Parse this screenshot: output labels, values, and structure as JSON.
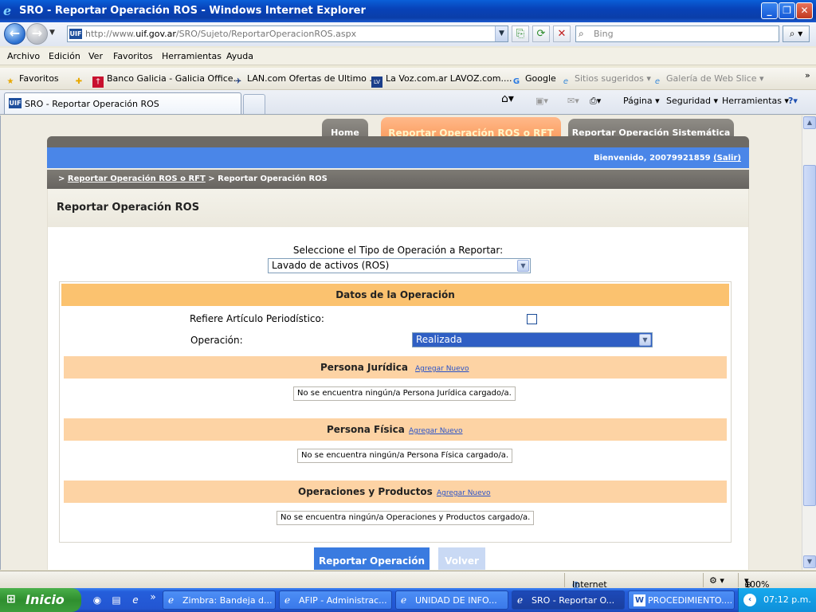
{
  "window": {
    "title": "SRO - Reportar Operación ROS - Windows Internet Explorer"
  },
  "address": {
    "url_prefix": "http://www.",
    "url_domain": "uif.gov.ar",
    "url_path": "/SRO/Sujeto/ReportarOperacionROS.aspx",
    "site_icon": "UIF"
  },
  "search": {
    "placeholder": "Bing"
  },
  "menu": {
    "items": [
      "Archivo",
      "Edición",
      "Ver",
      "Favoritos",
      "Herramientas",
      "Ayuda"
    ]
  },
  "favorites": {
    "label": "Favoritos",
    "items": [
      "Banco Galicia - Galicia Office...",
      "LAN.com Ofertas de Ultimo ...",
      "La Voz.com.ar  LAVOZ.com....",
      "Google",
      "Sitios sugeridos ▾",
      "Galería de Web Slice ▾"
    ]
  },
  "browser_tab": {
    "title": "SRO - Reportar Operación ROS"
  },
  "command_bar": {
    "pagina": "Página ▾",
    "seguridad": "Seguridad ▾",
    "herramientas": "Herramientas ▾"
  },
  "site_nav": {
    "home": "Home",
    "reportar_ros_rft": "Reportar Operación ROS o RFT",
    "reportar_sistematica": "Reportar Operación Sistemática"
  },
  "user_band": {
    "welcome": "Bienvenido, 20079921859",
    "salir": "(Salir)"
  },
  "breadcrumb": {
    "prefix": ">",
    "link": "Reportar Operación ROS o RFT",
    "current": "> Reportar Operación ROS"
  },
  "page": {
    "title": "Reportar Operación ROS",
    "select_label": "Seleccione el Tipo de Operación a Reportar:",
    "tipo_operacion": "Lavado de activos (ROS)"
  },
  "datos": {
    "header": "Datos de la Operación",
    "refiere_label": "Refiere Artículo Periodístico:",
    "refiere_checked": false,
    "operacion_label": "Operación:",
    "operacion_value": "Realizada"
  },
  "sections": [
    {
      "title": "Persona Jurídica",
      "add": "Agregar Nuevo",
      "empty": "No se encuentra ningún/a Persona Jurídica cargado/a."
    },
    {
      "title": "Persona Física",
      "add": "Agregar Nuevo",
      "empty": "No se encuentra ningún/a Persona Física cargado/a."
    },
    {
      "title": "Operaciones y Productos",
      "add": "Agregar Nuevo",
      "empty": "No se encuentra ningún/a Operaciones y Productos cargado/a."
    }
  ],
  "buttons": {
    "reportar": "Reportar Operación",
    "volver": "Volver"
  },
  "status": {
    "zone": "Internet",
    "zoom": "100%"
  },
  "taskbar": {
    "start": "Inicio",
    "tasks": [
      "Zimbra: Bandeja d...",
      "AFIP - Administrac...",
      "UNIDAD DE INFO...",
      "SRO - Reportar O...",
      "PROCEDIMIENTO...."
    ],
    "clock": "07:12 p.m."
  },
  "colors": {
    "accent_blue": "#4a86e8",
    "orange_tab": "#f9924f",
    "section_orange": "#fdd3a4",
    "header_orange": "#fbc26f"
  }
}
